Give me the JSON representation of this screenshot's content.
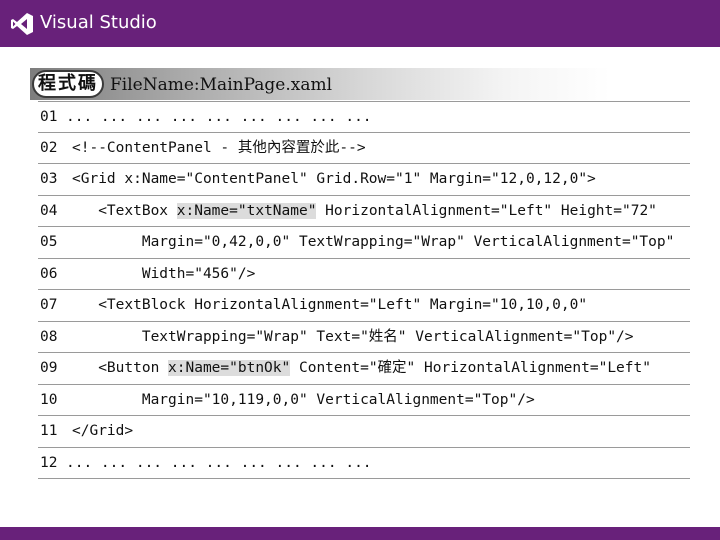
{
  "header": {
    "app_name": "Visual Studio",
    "logo_icon": "visual-studio-logo-icon",
    "brand_color": "#68217a"
  },
  "snippet": {
    "label": "程式碼",
    "file_name": "FileName:MainPage.xaml",
    "lines": [
      {
        "num": "01",
        "segments": [
          {
            "text": "... ... ... ... ... ... ... ... ...",
            "highlight": false
          }
        ]
      },
      {
        "num": "02",
        "segments": [
          {
            "text": "<!--ContentPanel - 其他內容置於此-->",
            "highlight": false
          }
        ]
      },
      {
        "num": "03",
        "segments": [
          {
            "text": "<Grid x:Name=\"ContentPanel\" Grid.Row=\"1\" Margin=\"12,0,12,0\">",
            "highlight": false
          }
        ]
      },
      {
        "num": "04",
        "segments": [
          {
            "text": "   <TextBox ",
            "highlight": false
          },
          {
            "text": "x:Name=\"txtName\"",
            "highlight": true
          },
          {
            "text": " HorizontalAlignment=\"Left\" Height=\"72\"",
            "highlight": false
          }
        ]
      },
      {
        "num": "05",
        "segments": [
          {
            "text": "        Margin=\"0,42,0,0\" TextWrapping=\"Wrap\" VerticalAlignment=\"Top\"",
            "highlight": false
          }
        ]
      },
      {
        "num": "06",
        "segments": [
          {
            "text": "        Width=\"456\"/>",
            "highlight": false
          }
        ]
      },
      {
        "num": "07",
        "segments": [
          {
            "text": "   <TextBlock HorizontalAlignment=\"Left\" Margin=\"10,10,0,0\"",
            "highlight": false
          }
        ]
      },
      {
        "num": "08",
        "segments": [
          {
            "text": "        TextWrapping=\"Wrap\" Text=\"姓名\" VerticalAlignment=\"Top\"/>",
            "highlight": false
          }
        ]
      },
      {
        "num": "09",
        "segments": [
          {
            "text": "   <Button ",
            "highlight": false
          },
          {
            "text": "x:Name=\"btnOk\"",
            "highlight": true
          },
          {
            "text": " Content=\"確定\" HorizontalAlignment=\"Left\"",
            "highlight": false
          }
        ]
      },
      {
        "num": "10",
        "segments": [
          {
            "text": "        Margin=\"10,119,0,0\" VerticalAlignment=\"Top\"/>",
            "highlight": false
          }
        ]
      },
      {
        "num": "11",
        "segments": [
          {
            "text": "</Grid>",
            "highlight": false
          }
        ]
      },
      {
        "num": "12",
        "segments": [
          {
            "text": "... ... ... ... ... ... ... ... ...",
            "highlight": false
          }
        ]
      }
    ]
  }
}
